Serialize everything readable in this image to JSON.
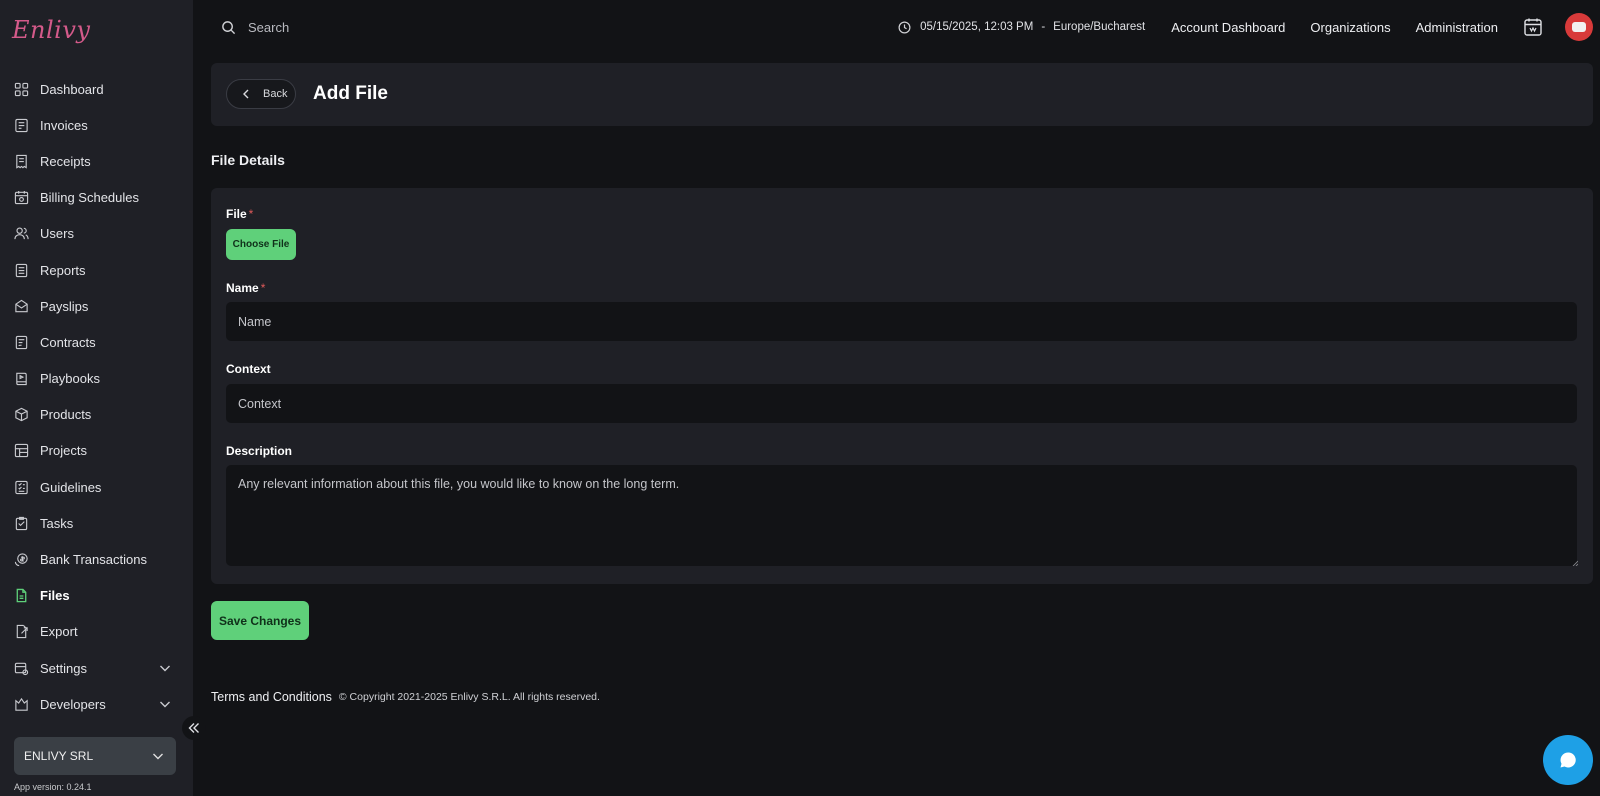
{
  "app": {
    "logo_text": "Enlivy",
    "version": "App version: 0.24.1"
  },
  "colors": {
    "accent": "#5fd07a",
    "background": "#121316",
    "panel": "#1f2026",
    "chat": "#1ea0e6",
    "required": "#e05a5a"
  },
  "sidebar": {
    "items": [
      {
        "label": "Dashboard",
        "icon": "dashboard-icon"
      },
      {
        "label": "Invoices",
        "icon": "invoice-icon"
      },
      {
        "label": "Receipts",
        "icon": "receipt-icon"
      },
      {
        "label": "Billing Schedules",
        "icon": "billing-schedule-icon"
      },
      {
        "label": "Users",
        "icon": "users-icon"
      },
      {
        "label": "Reports",
        "icon": "reports-icon"
      },
      {
        "label": "Payslips",
        "icon": "payslip-icon"
      },
      {
        "label": "Contracts",
        "icon": "contract-icon"
      },
      {
        "label": "Playbooks",
        "icon": "playbook-icon"
      },
      {
        "label": "Products",
        "icon": "product-box-icon"
      },
      {
        "label": "Projects",
        "icon": "projects-icon"
      },
      {
        "label": "Guidelines",
        "icon": "guidelines-icon"
      },
      {
        "label": "Tasks",
        "icon": "tasks-icon"
      },
      {
        "label": "Bank Transactions",
        "icon": "bank-transaction-icon"
      },
      {
        "label": "Files",
        "icon": "file-icon",
        "active": true
      },
      {
        "label": "Export",
        "icon": "export-icon"
      },
      {
        "label": "Settings",
        "icon": "settings-icon",
        "expandable": true
      },
      {
        "label": "Developers",
        "icon": "developers-icon",
        "expandable": true
      }
    ],
    "organization": "ENLIVY SRL"
  },
  "topbar": {
    "search_placeholder": "Search",
    "datetime": "05/15/2025, 12:03 PM",
    "separator": "-",
    "timezone": "Europe/Bucharest",
    "links": [
      "Account Dashboard",
      "Organizations",
      "Administration"
    ]
  },
  "page": {
    "back_label": "Back",
    "title": "Add File",
    "section_title": "File Details"
  },
  "form": {
    "file_label": "File",
    "required_mark": "*",
    "choose_file_label": "Choose File",
    "name_label": "Name",
    "name_placeholder": "Name",
    "name_value": "",
    "context_label": "Context",
    "context_placeholder": "Context",
    "context_value": "",
    "description_label": "Description",
    "description_placeholder": "Any relevant information about this file, you would like to know on the long term.",
    "description_value": "",
    "save_label": "Save Changes"
  },
  "footer": {
    "terms": "Terms and Conditions",
    "copyright": "© Copyright 2021-2025 Enlivy S.R.L. All rights reserved."
  }
}
